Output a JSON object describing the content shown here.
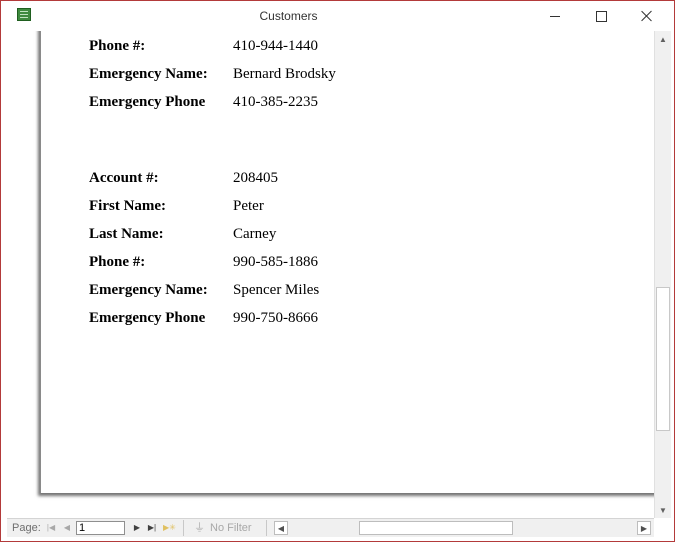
{
  "window": {
    "title": "Customers"
  },
  "title_bar": {
    "app_icon": "table-icon",
    "controls": {
      "minimize": "minimize-icon",
      "maximize": "maximize-icon",
      "close": "close-icon"
    }
  },
  "report": {
    "partial_record": [
      {
        "label": "Phone #:",
        "value": "410-944-1440"
      },
      {
        "label": "Emergency Name:",
        "value": "Bernard Brodsky"
      },
      {
        "label": "Emergency Phone",
        "value": "410-385-2235"
      }
    ],
    "record": [
      {
        "label": "Account #:",
        "value": "208405"
      },
      {
        "label": "First Name:",
        "value": "Peter"
      },
      {
        "label": "Last Name:",
        "value": "Carney"
      },
      {
        "label": "Phone #:",
        "value": "990-585-1886"
      },
      {
        "label": "Emergency Name:",
        "value": "Spencer Miles"
      },
      {
        "label": "Emergency Phone",
        "value": "990-750-8666"
      }
    ]
  },
  "navigation": {
    "page_label": "Page:",
    "page_value": "1",
    "first_icon": "first-page-icon",
    "prev_icon": "previous-page-icon",
    "next_icon": "next-page-icon",
    "last_icon": "last-page-icon",
    "new_icon": "new-record-icon",
    "filter_icon": "no-filter-icon",
    "filter_label": "No Filter"
  },
  "scrollbars": {
    "up_icon": "scroll-up-icon",
    "down_icon": "scroll-down-icon",
    "left_icon": "scroll-left-icon",
    "right_icon": "scroll-right-icon"
  }
}
